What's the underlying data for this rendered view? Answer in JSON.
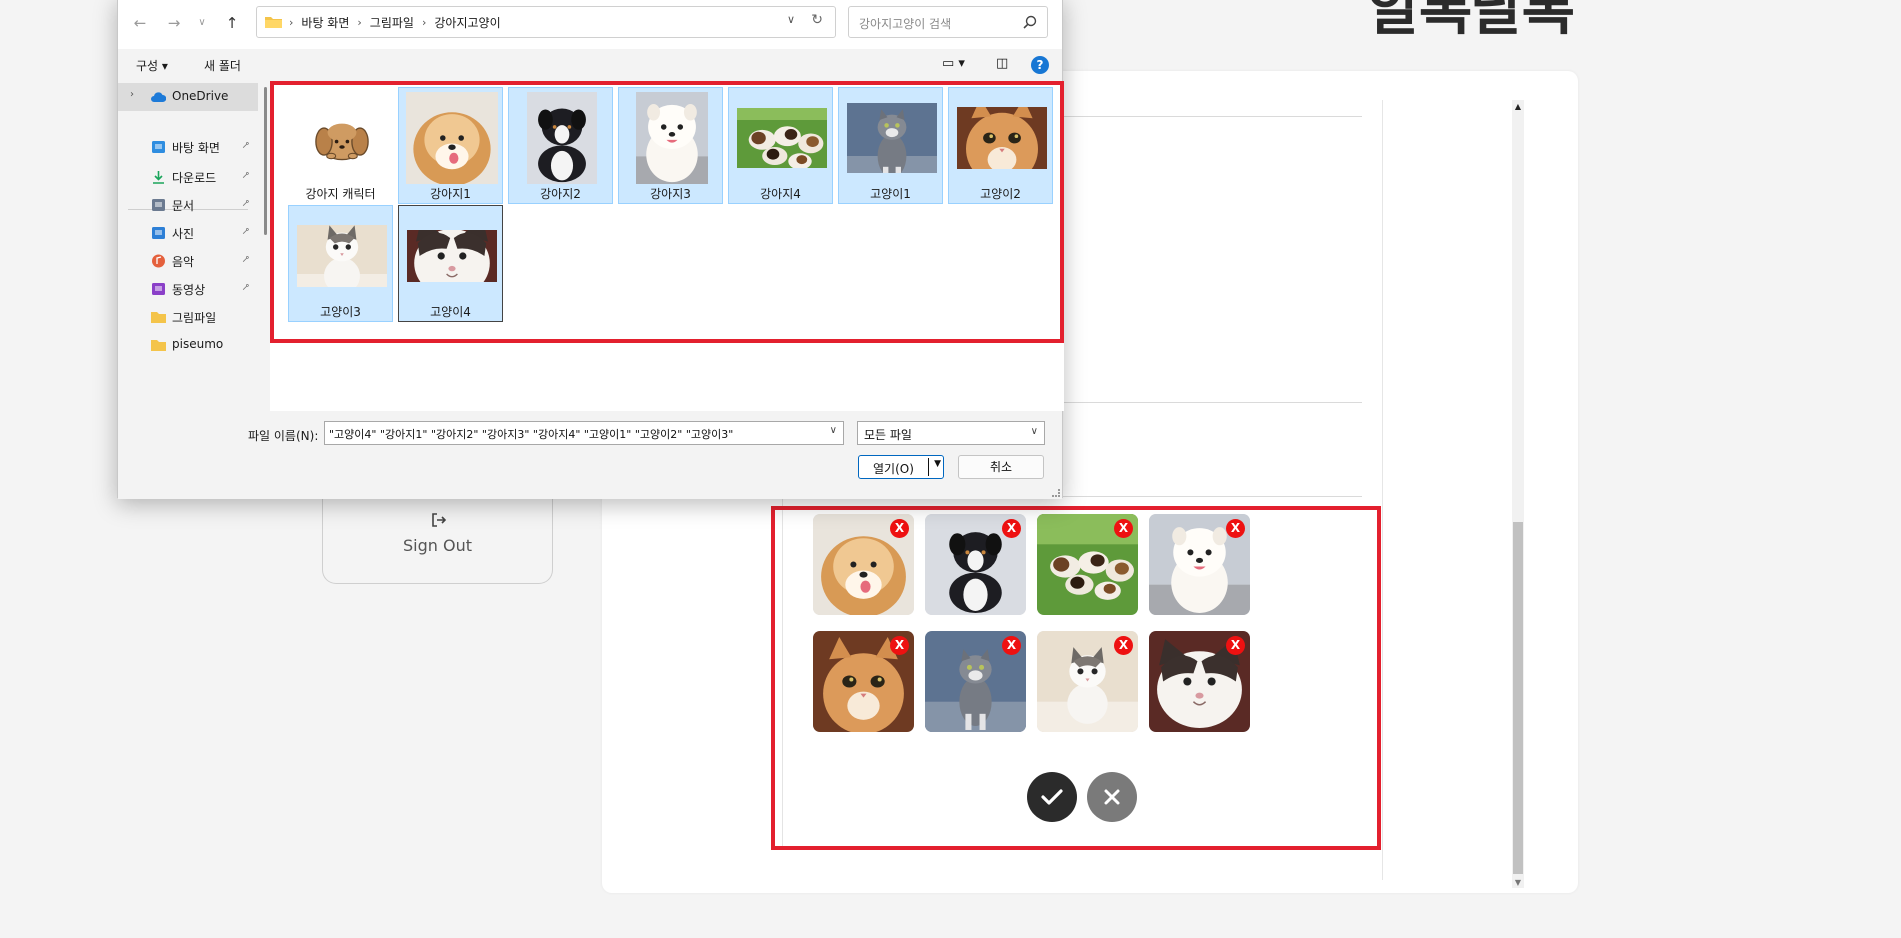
{
  "page": {
    "site_title": "알록달록",
    "signout_label": "Sign Out"
  },
  "dialog": {
    "breadcrumbs": [
      "바탕 화면",
      "그림파일",
      "강아지고양이"
    ],
    "search_placeholder": "강아지고양이 검색",
    "toolbar": {
      "organize_label": "구성 ▾",
      "new_folder_label": "새 폴더",
      "view_label": "▭ ▾",
      "pane_label": "◫",
      "help_label": "?"
    },
    "nav_items": [
      {
        "label": "OneDrive",
        "icon": "cloud-icon",
        "color": "#1d7ad8",
        "pinned": false
      },
      {
        "label": "바탕 화면",
        "icon": "desktop-icon",
        "color": "#2e8de0",
        "pinned": true
      },
      {
        "label": "다운로드",
        "icon": "download-icon",
        "color": "#1aa55b",
        "pinned": true
      },
      {
        "label": "문서",
        "icon": "document-icon",
        "color": "#6b7a90",
        "pinned": true
      },
      {
        "label": "사진",
        "icon": "pictures-icon",
        "color": "#2d7fd6",
        "pinned": true
      },
      {
        "label": "음악",
        "icon": "music-icon",
        "color": "#e4603c",
        "pinned": true
      },
      {
        "label": "동영상",
        "icon": "video-icon",
        "color": "#8a3fc8",
        "pinned": true
      },
      {
        "label": "그림파일",
        "icon": "folder-icon",
        "color": "#f4c44a",
        "pinned": false
      },
      {
        "label": "piseumo",
        "icon": "folder-icon",
        "color": "#f4c44a",
        "pinned": false
      }
    ],
    "files": [
      {
        "name": "강아지 캐릭터",
        "selected": false,
        "focused": false,
        "thumb": "character"
      },
      {
        "name": "강아지1",
        "selected": true,
        "focused": false,
        "thumb": "pom"
      },
      {
        "name": "강아지2",
        "selected": true,
        "focused": false,
        "thumb": "puppy-black"
      },
      {
        "name": "강아지3",
        "selected": true,
        "focused": false,
        "thumb": "white-dog"
      },
      {
        "name": "강아지4",
        "selected": true,
        "focused": false,
        "thumb": "beagles"
      },
      {
        "name": "고양이1",
        "selected": true,
        "focused": false,
        "thumb": "cat-gray"
      },
      {
        "name": "고양이2",
        "selected": true,
        "focused": false,
        "thumb": "cat-orange"
      },
      {
        "name": "고양이3",
        "selected": true,
        "focused": false,
        "thumb": "cat-white"
      },
      {
        "name": "고양이4",
        "selected": true,
        "focused": true,
        "thumb": "cat-face"
      }
    ],
    "filename_label": "파일 이름(N):",
    "filename_value": "\"고양이4\" \"강아지1\" \"강아지2\" \"강아지3\" \"강아지4\" \"고양이1\" \"고양이2\" \"고양이3\"",
    "filetype_value": "모든 파일",
    "open_label": "열기(O)",
    "cancel_label": "취소"
  },
  "preview": {
    "images": [
      {
        "thumb": "pom",
        "remove_label": "X"
      },
      {
        "thumb": "puppy-black",
        "remove_label": "X"
      },
      {
        "thumb": "beagles",
        "remove_label": "X"
      },
      {
        "thumb": "white-dog",
        "remove_label": "X"
      },
      {
        "thumb": "cat-orange",
        "remove_label": "X"
      },
      {
        "thumb": "cat-gray",
        "remove_label": "X"
      },
      {
        "thumb": "cat-white",
        "remove_label": "X"
      },
      {
        "thumb": "cat-face",
        "remove_label": "X"
      }
    ],
    "confirm_icon": "check-icon",
    "cancel_icon": "close-icon"
  },
  "colors": {
    "highlight_border": "#e3202e",
    "selected_tile_bg": "#cce8ff",
    "remove_badge": "#ee1111",
    "confirm_button": "#2b2b2b",
    "cancel_button": "#7a7a7a"
  }
}
